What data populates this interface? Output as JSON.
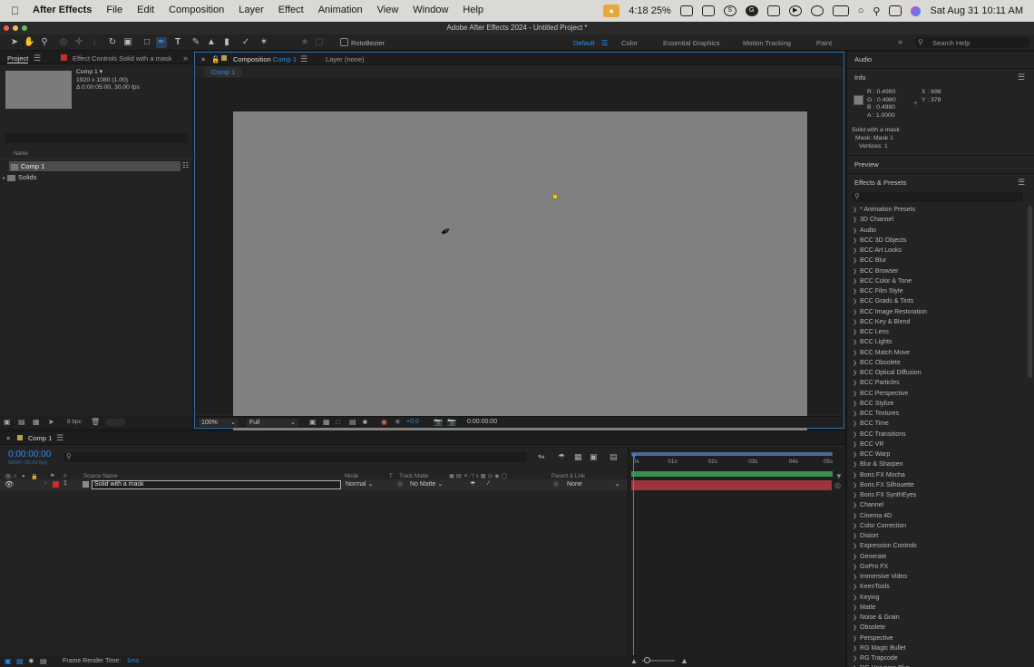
{
  "menubar": {
    "app_name": "After Effects",
    "items": [
      "File",
      "Edit",
      "Composition",
      "Layer",
      "Effect",
      "Animation",
      "View",
      "Window",
      "Help"
    ],
    "status": {
      "timer": "4:18",
      "battery_percent": "25%",
      "date_time": "Sat Aug 31  10:11 AM"
    }
  },
  "window": {
    "title": "Adobe After Effects 2024 - Untitled Project *"
  },
  "toolbar": {
    "rotobezier_label": "RotoBezier",
    "workspaces": [
      "Default",
      "Color",
      "Essential Graphics",
      "Motion Tracking",
      "Paint"
    ],
    "active_workspace": "Default",
    "search_help_placeholder": "Search Help"
  },
  "project_panel": {
    "tab_project": "Project",
    "tab_effect_controls": "Effect Controls Solid with a mask",
    "comp_name": "Comp 1 ▾",
    "comp_resolution": "1920 x 1080 (1.00)",
    "comp_duration": "Δ 0:00:05:00, 30.00 fps",
    "column_name": "Name",
    "items": [
      {
        "label": "Comp 1",
        "type": "composition"
      },
      {
        "label": "Solids",
        "type": "folder"
      }
    ],
    "bpc": "8 bpc"
  },
  "composition_panel": {
    "tab_label": "Composition",
    "tab_comp_name": "Comp 1",
    "layer_tab": "Layer (none)",
    "breadcrumb": "Comp 1",
    "zoom": "100%",
    "resolution": "Full",
    "exposure": "+0.0",
    "timecode": "0:00:00:00"
  },
  "info_panel": {
    "audio_label": "Audio",
    "title": "Info",
    "r": "R : 0.4980",
    "g": "G : 0.4980",
    "b": "B : 0.4980",
    "a": "A : 1.0000",
    "x": "X : 698",
    "y": "Y : 378",
    "layer_name": "Solid with a mask",
    "mask": "Mask: Mask 1",
    "vertices": "Vertices: 1",
    "preview_label": "Preview"
  },
  "effects_panel": {
    "title": "Effects & Presets",
    "items": [
      "* Animation Presets",
      "3D Channel",
      "Audio",
      "BCC 3D Objects",
      "BCC Art Looks",
      "BCC Blur",
      "BCC Browser",
      "BCC Color & Tone",
      "BCC Film Style",
      "BCC Grads & Tints",
      "BCC Image Restoration",
      "BCC Key & Blend",
      "BCC Lens",
      "BCC Lights",
      "BCC Match Move",
      "BCC Obsolete",
      "BCC Optical Diffusion",
      "BCC Particles",
      "BCC Perspective",
      "BCC Stylize",
      "BCC Textures",
      "BCC Time",
      "BCC Transitions",
      "BCC VR",
      "BCC Warp",
      "Blur & Sharpen",
      "Boris FX Mocha",
      "Boris FX Silhouette",
      "Boris FX SynthEyes",
      "Channel",
      "Cinema 4D",
      "Color Correction",
      "Distort",
      "Expression Controls",
      "Generate",
      "GoPro FX",
      "Immersive Video",
      "KeenTools",
      "Keying",
      "Matte",
      "Noise & Grain",
      "Obsolete",
      "Perspective",
      "RG Magic Bullet",
      "RG Trapcode",
      "RG Universe Blur"
    ]
  },
  "timeline": {
    "tab_label": "Comp 1",
    "timecode": "0:00:00:00",
    "frame_info": "00000 (30.00 fps)",
    "columns": {
      "source_name": "Source Name",
      "mode": "Mode",
      "t": "T",
      "track_matte": "Track Matte",
      "parent_link": "Parent & Link",
      "number": "#"
    },
    "ruler": [
      "0s",
      "01s",
      "02s",
      "03s",
      "04s",
      "05s"
    ],
    "layer": {
      "number": "1",
      "name": "Solid with a mask",
      "mode": "Normal",
      "track_matte": "No Matte",
      "parent": "None",
      "label_color": "#c4302b"
    }
  },
  "statusbar": {
    "label": "Frame Render Time:",
    "value": "1ms"
  },
  "colors": {
    "accent_blue": "#2d8ceb",
    "timeline_green": "#3a8f4f",
    "layer_bar_red": "#b43a3f",
    "comp_gray": "#808080"
  }
}
